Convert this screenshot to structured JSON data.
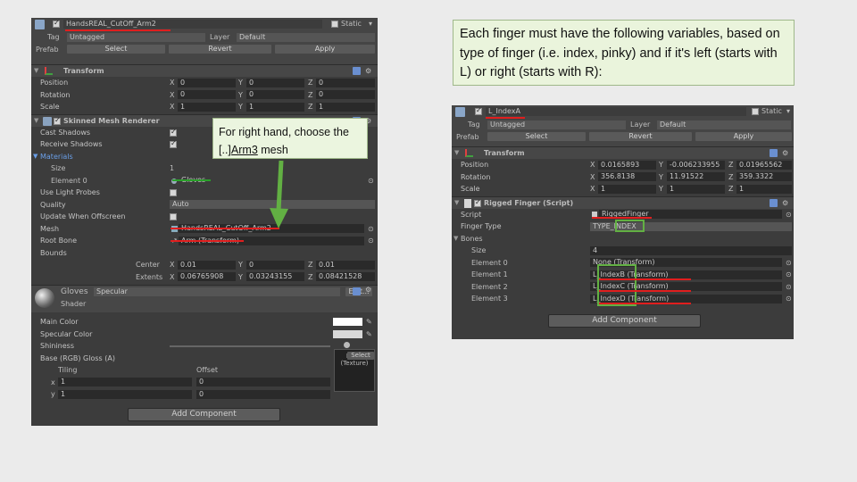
{
  "left_inspector": {
    "object_name": "HandsREAL_CutOff_Arm2",
    "static_label": "Static",
    "tag_label": "Tag",
    "tag_value": "Untagged",
    "layer_label": "Layer",
    "layer_value": "Default",
    "prefab_label": "Prefab",
    "prefab_select": "Select",
    "prefab_revert": "Revert",
    "prefab_apply": "Apply",
    "transform": {
      "title": "Transform",
      "position_label": "Position",
      "position": [
        "0",
        "0",
        "0"
      ],
      "rotation_label": "Rotation",
      "rotation": [
        "0",
        "0",
        "0"
      ],
      "scale_label": "Scale",
      "scale": [
        "1",
        "1",
        "1"
      ]
    },
    "axes": [
      "X",
      "Y",
      "Z"
    ],
    "smr": {
      "title": "Skinned Mesh Renderer",
      "cast_shadows": "Cast Shadows",
      "receive_shadows": "Receive Shadows",
      "materials": "Materials",
      "size_label": "Size",
      "size_value": "1",
      "element0_label": "Element 0",
      "element0_value": "Gloves",
      "use_light_probes": "Use Light Probes",
      "quality_label": "Quality",
      "quality_value": "Auto",
      "update_offscreen": "Update When Offscreen",
      "mesh_label": "Mesh",
      "mesh_value": "HandsREAL_CutOff_Arm2",
      "root_bone_label": "Root Bone",
      "root_bone_value": "Arm (Transform)",
      "bounds_label": "Bounds",
      "center_label": "Center",
      "center": [
        "0.01",
        "0",
        "0.01"
      ],
      "extents_label": "Extents",
      "extents": [
        "0.06765908",
        "0.03243155",
        "0.08421528"
      ]
    },
    "material": {
      "name": "Gloves",
      "shader_label": "Shader",
      "shader_value": "Specular",
      "edit_label": "Edit...",
      "main_color": "Main Color",
      "specular_color": "Specular Color",
      "shininess": "Shininess",
      "base_label": "Base (RGB) Gloss (A)",
      "tiling_label": "Tiling",
      "offset_label": "Offset",
      "x_label": "x",
      "y_label": "y",
      "tiling": [
        "1",
        "1"
      ],
      "offset": [
        "0",
        "0"
      ],
      "texture_none": "None",
      "texture_type": "(Texture)",
      "select_label": "Select"
    },
    "add_component": "Add Component"
  },
  "right_inspector": {
    "object_name": "L_IndexA",
    "static_label": "Static",
    "tag_label": "Tag",
    "tag_value": "Untagged",
    "layer_label": "Layer",
    "layer_value": "Default",
    "prefab_label": "Prefab",
    "prefab_select": "Select",
    "prefab_revert": "Revert",
    "prefab_apply": "Apply",
    "axes": [
      "X",
      "Y",
      "Z"
    ],
    "transform": {
      "title": "Transform",
      "position_label": "Position",
      "position": [
        "0.0165893",
        "-0.006233955",
        "0.01965562"
      ],
      "rotation_label": "Rotation",
      "rotation": [
        "356.8138",
        "11.91522",
        "359.3322"
      ],
      "scale_label": "Scale",
      "scale": [
        "1",
        "1",
        "1"
      ]
    },
    "rigged_finger": {
      "title": "Rigged Finger (Script)",
      "script_label": "Script",
      "script_value": "RiggedFinger",
      "finger_type_label": "Finger Type",
      "finger_type_value": "TYPE_INDEX",
      "bones_label": "Bones",
      "size_label": "Size",
      "size_value": "4",
      "elements": [
        {
          "label": "Element 0",
          "value": "None (Transform)"
        },
        {
          "label": "Element 1",
          "value": "L_IndexB (Transform)"
        },
        {
          "label": "Element 2",
          "value": "L_IndexC (Transform)"
        },
        {
          "label": "Element 3",
          "value": "L_IndexD (Transform)"
        }
      ]
    },
    "add_component": "Add Component"
  },
  "notes": {
    "top": "Each finger must have the following variables, based on type of finger (i.e. index, pinky) and if it's left (starts with L) or right (starts with R):",
    "mid_prefix": "For right hand, choose the [..]",
    "mid_underlined": "Arm3",
    "mid_suffix": " mesh"
  },
  "colors": {
    "annotation_red": "#e01e1e",
    "annotation_green": "#2aa02a",
    "note_bg": "#eaf4dc"
  }
}
